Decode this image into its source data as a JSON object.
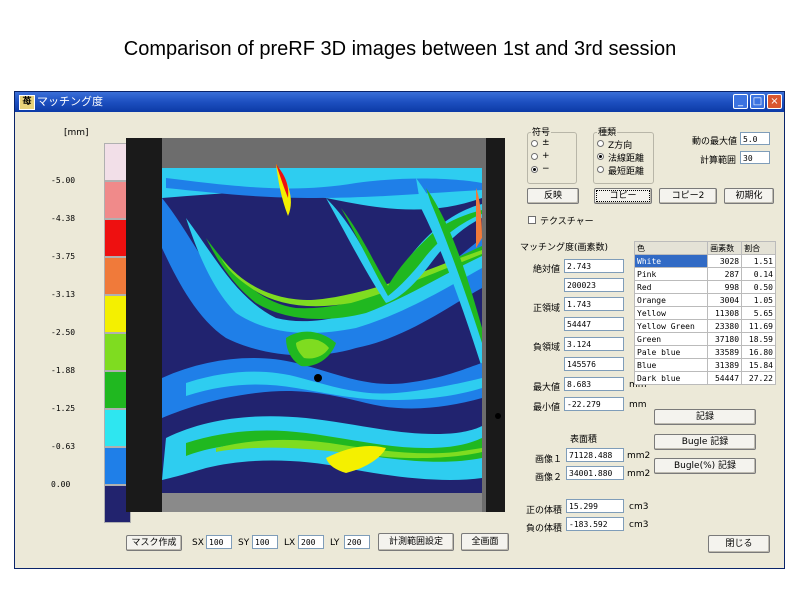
{
  "slide_title": "Comparison of preRF 3D images between 1st and 3rd session",
  "window": {
    "title": "マッチング度",
    "app_icon": "苺",
    "buttons": {
      "minimize": "_",
      "maximize": "□",
      "close": "×"
    }
  },
  "legend": {
    "unit": "[mm]",
    "labels": [
      "-5.00",
      "-4.38",
      "-3.75",
      "-3.13",
      "-2.50",
      "-1.88",
      "-1.25",
      "-0.63",
      "0.00"
    ],
    "colors": [
      "#f2dfe8",
      "#f08a8a",
      "#ee1010",
      "#f07a3a",
      "#f4f000",
      "#7fdc20",
      "#20b820",
      "#2ee6f0",
      "#1f7fe8",
      "#22236e"
    ]
  },
  "groups": {
    "sign": {
      "title": "符号",
      "options": [
        "±",
        "+",
        "−"
      ],
      "selected": 2
    },
    "type": {
      "title": "種類",
      "options": [
        "Z方向",
        "法線距離",
        "最短距離"
      ],
      "selected": 1
    }
  },
  "params": {
    "max_label": "動の最大値",
    "max_value": "5.0",
    "range_label": "計算範囲",
    "range_value": "30"
  },
  "top_buttons": [
    "反映",
    "コピー",
    "コピー2",
    "初期化"
  ],
  "texture_label": "テクスチャー",
  "match_section": {
    "title": "マッチング度(画素数)",
    "rows": [
      {
        "label": "絶対値",
        "value": "2.743",
        "sub": "200023"
      },
      {
        "label": "正領域",
        "value": "1.743",
        "sub": "54447"
      },
      {
        "label": "負領域",
        "value": "3.124",
        "sub": "145576"
      }
    ],
    "max_label": "最大値",
    "max_value": "8.683",
    "min_label": "最小値",
    "min_value": "-22.279",
    "unit": "mm"
  },
  "color_table": {
    "headers": [
      "色",
      "画素数",
      "割合"
    ],
    "rows": [
      {
        "name": "White",
        "count": "3028",
        "pct": "1.51"
      },
      {
        "name": "Pink",
        "count": "287",
        "pct": "0.14"
      },
      {
        "name": "Red",
        "count": "998",
        "pct": "0.50"
      },
      {
        "name": "Orange",
        "count": "3004",
        "pct": "1.05"
      },
      {
        "name": "Yellow",
        "count": "11308",
        "pct": "5.65"
      },
      {
        "name": "Yellow Green",
        "count": "23380",
        "pct": "11.69"
      },
      {
        "name": "Green",
        "count": "37180",
        "pct": "18.59"
      },
      {
        "name": "Pale blue",
        "count": "33589",
        "pct": "16.80"
      },
      {
        "name": "Blue",
        "count": "31389",
        "pct": "15.84"
      },
      {
        "name": "Dark blue",
        "count": "54447",
        "pct": "27.22"
      }
    ],
    "selected_row": 0
  },
  "right_buttons": [
    "記録",
    "Bugle 記録",
    "Bugle(%) 記録"
  ],
  "surface": {
    "title": "表面積",
    "image1_label": "画像１",
    "image1_value": "71128.488",
    "image2_label": "画像２",
    "image2_value": "34001.880",
    "unit": "mm2"
  },
  "volume": {
    "positive_label": "正の体積",
    "positive_value": "15.299",
    "negative_label": "負の体積",
    "negative_value": "-183.592",
    "unit": "cm3"
  },
  "bottom": {
    "mask_button": "マスク作成",
    "sx_label": "SX",
    "sx_value": "100",
    "sy_label": "SY",
    "sy_value": "100",
    "lx_label": "LX",
    "lx_value": "200",
    "ly_label": "LY",
    "ly_value": "200",
    "range_button": "計測範囲設定",
    "full_button": "全画面",
    "close_button": "閉じる"
  }
}
